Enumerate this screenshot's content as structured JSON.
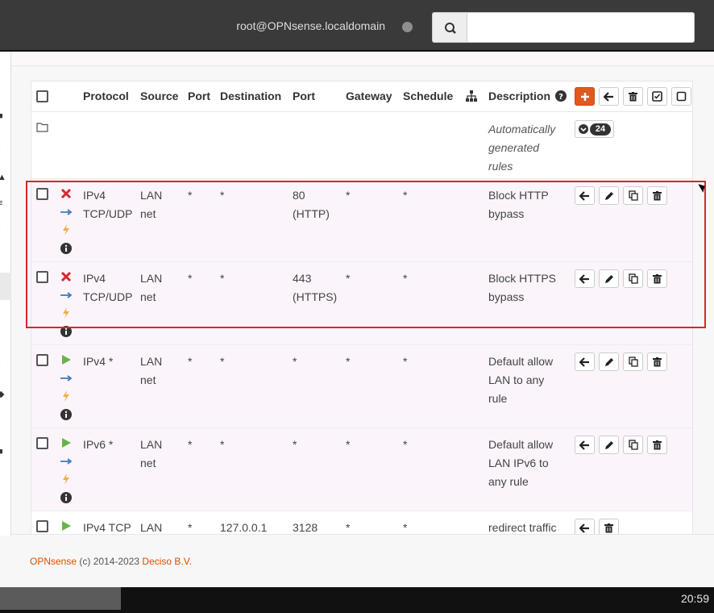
{
  "header": {
    "user": "root@OPNsense.localdomain",
    "search": {
      "placeholder": "",
      "value": ""
    }
  },
  "table": {
    "columns": {
      "protocol": "Protocol",
      "source": "Source",
      "port": "Port",
      "destination": "Destination",
      "dport": "Port",
      "gateway": "Gateway",
      "schedule": "Schedule",
      "description": "Description"
    },
    "auto_row": {
      "description": "Automatically generated rules",
      "desc_l1": "Automatically",
      "desc_l2": "generated",
      "desc_l3": "rules",
      "count": "24"
    },
    "rows": [
      {
        "status": "block",
        "protocol_l1": "IPv4",
        "protocol_l2": "TCP/UDP",
        "source_l1": "LAN",
        "source_l2": "net",
        "sport": "*",
        "destination": "*",
        "dport_l1": "80",
        "dport_l2": "(HTTP)",
        "gateway": "*",
        "schedule": "*",
        "desc_l1": "Block HTTP",
        "desc_l2": "bypass",
        "desc_l3": ""
      },
      {
        "status": "block",
        "protocol_l1": "IPv4",
        "protocol_l2": "TCP/UDP",
        "source_l1": "LAN",
        "source_l2": "net",
        "sport": "*",
        "destination": "*",
        "dport_l1": "443",
        "dport_l2": "(HTTPS)",
        "gateway": "*",
        "schedule": "*",
        "desc_l1": "Block HTTPS",
        "desc_l2": "bypass",
        "desc_l3": ""
      },
      {
        "status": "pass",
        "protocol_l1": "IPv4 *",
        "protocol_l2": "",
        "source_l1": "LAN",
        "source_l2": "net",
        "sport": "*",
        "destination": "*",
        "dport_l1": "*",
        "dport_l2": "",
        "gateway": "*",
        "schedule": "*",
        "desc_l1": "Default allow",
        "desc_l2": "LAN to any",
        "desc_l3": "rule"
      },
      {
        "status": "pass",
        "protocol_l1": "IPv6 *",
        "protocol_l2": "",
        "source_l1": "LAN",
        "source_l2": "net",
        "sport": "*",
        "destination": "*",
        "dport_l1": "*",
        "dport_l2": "",
        "gateway": "*",
        "schedule": "*",
        "desc_l1": "Default allow",
        "desc_l2": "LAN IPv6 to",
        "desc_l3": "any rule"
      },
      {
        "status": "pass",
        "protocol_l1": "IPv4 TCP",
        "protocol_l2": "",
        "source_l1": "LAN",
        "source_l2": "",
        "sport": "*",
        "destination": "127.0.0.1",
        "dport_l1": "3128",
        "dport_l2": "",
        "gateway": "*",
        "schedule": "*",
        "desc_l1": "redirect traffic",
        "desc_l2": "",
        "desc_l3": ""
      }
    ]
  },
  "footer": {
    "brand": "OPNsense",
    "copyright": " (c) 2014-2023 ",
    "company": "Deciso B.V."
  },
  "taskbar": {
    "clock": "20:59"
  },
  "colors": {
    "accent": "#e2571e",
    "block": "#d9262c",
    "pass": "#69b34c",
    "log": "#f0ad4e",
    "highlight": "#d9262c"
  },
  "icons": [
    "search-icon",
    "status-dot-icon",
    "add-icon",
    "arrow-left-icon",
    "trash-icon",
    "check-square-icon",
    "square-icon",
    "folder-icon",
    "chevron-circle-icon",
    "sitemap-icon",
    "help-icon",
    "block-x-icon",
    "pass-play-icon",
    "direction-arrow-icon",
    "bolt-icon",
    "info-icon",
    "pencil-icon",
    "copy-icon"
  ]
}
